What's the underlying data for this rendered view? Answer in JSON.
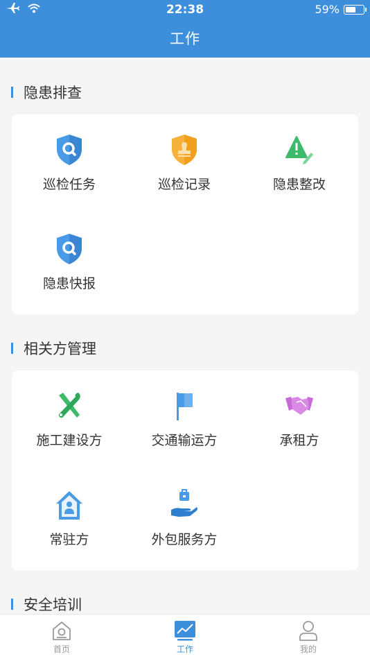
{
  "status_bar": {
    "time": "22:38",
    "battery": "59%",
    "battery_level": 0.59
  },
  "header": {
    "title": "工作"
  },
  "sections": [
    {
      "title": "隐患排查",
      "items": [
        {
          "label": "巡检任务",
          "icon": "shield-search-icon",
          "color": "#4a9be6"
        },
        {
          "label": "巡检记录",
          "icon": "shield-stamp-icon",
          "color": "#f5a623"
        },
        {
          "label": "隐患整改",
          "icon": "warning-edit-icon",
          "color": "#3dbb6a"
        },
        {
          "label": "隐患快报",
          "icon": "shield-search-icon",
          "color": "#4a9be6"
        }
      ]
    },
    {
      "title": "相关方管理",
      "items": [
        {
          "label": "施工建设方",
          "icon": "tools-icon",
          "color": "#3dbb6a"
        },
        {
          "label": "交通输运方",
          "icon": "flag-icon",
          "color": "#4a9be6"
        },
        {
          "label": "承租方",
          "icon": "handshake-icon",
          "color": "#c86ad8"
        },
        {
          "label": "常驻方",
          "icon": "house-user-icon",
          "color": "#4a9be6"
        },
        {
          "label": "外包服务方",
          "icon": "hand-briefcase-icon",
          "color": "#2e7fd0"
        }
      ]
    },
    {
      "title": "安全培训",
      "items": []
    }
  ],
  "tabbar": {
    "items": [
      {
        "label": "首页",
        "icon": "home-icon",
        "active": false
      },
      {
        "label": "工作",
        "icon": "chart-icon",
        "active": true
      },
      {
        "label": "我的",
        "icon": "user-icon",
        "active": false
      }
    ]
  },
  "colors": {
    "primary": "#3d8fdc",
    "background": "#f5f5f5"
  }
}
